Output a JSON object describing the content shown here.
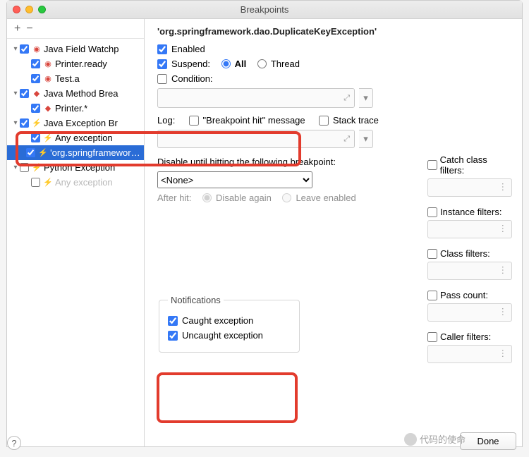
{
  "window": {
    "title": "Breakpoints"
  },
  "toolbar": {
    "add": "+",
    "remove": "−"
  },
  "tree": [
    {
      "level": 0,
      "arrow": "▾",
      "checked": true,
      "iconClass": "eye",
      "icon": "◉",
      "label": "Java Field Watchp",
      "sel": false,
      "enabled": true
    },
    {
      "level": 1,
      "arrow": "",
      "checked": true,
      "iconClass": "eye",
      "icon": "◉",
      "label": "Printer.ready",
      "sel": false,
      "enabled": true
    },
    {
      "level": 1,
      "arrow": "",
      "checked": true,
      "iconClass": "eye",
      "icon": "◉",
      "label": "Test.a",
      "sel": false,
      "enabled": true
    },
    {
      "level": 0,
      "arrow": "▾",
      "checked": true,
      "iconClass": "diamond",
      "icon": "◆",
      "label": "Java Method Brea",
      "sel": false,
      "enabled": true
    },
    {
      "level": 1,
      "arrow": "",
      "checked": true,
      "iconClass": "diamond",
      "icon": "◆",
      "label": "Printer.*",
      "sel": false,
      "enabled": true
    },
    {
      "level": 0,
      "arrow": "▾",
      "checked": true,
      "iconClass": "bolt",
      "icon": "⚡",
      "label": "Java Exception Br",
      "sel": false,
      "enabled": true
    },
    {
      "level": 1,
      "arrow": "",
      "checked": true,
      "iconClass": "bolt",
      "icon": "⚡",
      "label": "Any exception",
      "sel": false,
      "enabled": true
    },
    {
      "level": 1,
      "arrow": "",
      "checked": true,
      "iconClass": "bolt",
      "icon": "⚡",
      "label": "'org.springframework.dao.DuplicateKeyException'",
      "sel": true,
      "enabled": true
    },
    {
      "level": 0,
      "arrow": "▾",
      "checked": false,
      "iconClass": "bolt",
      "icon": "⚡",
      "label": "Python Exception",
      "sel": false,
      "enabled": true
    },
    {
      "level": 1,
      "arrow": "",
      "checked": false,
      "iconClass": "bolt",
      "icon": "⚡",
      "label": "Any exception",
      "sel": false,
      "enabled": false
    }
  ],
  "detail": {
    "header": "'org.springframework.dao.DuplicateKeyException'",
    "enabled_label": "Enabled",
    "suspend_label": "Suspend:",
    "suspend_all": "All",
    "suspend_thread": "Thread",
    "condition_label": "Condition:",
    "log_label": "Log:",
    "log_hit": "\"Breakpoint hit\" message",
    "stack_trace": "Stack trace",
    "disable_until": "Disable until hitting the following breakpoint:",
    "none_option": "<None>",
    "after_hit": "After hit:",
    "disable_again": "Disable again",
    "leave_enabled": "Leave enabled",
    "notifications_legend": "Notifications",
    "caught": "Caught exception",
    "uncaught": "Uncaught exception"
  },
  "filters": {
    "catch": "Catch class filters:",
    "instance": "Instance filters:",
    "class": "Class filters:",
    "pass": "Pass count:",
    "caller": "Caller filters:"
  },
  "footer": {
    "done": "Done",
    "help": "?"
  },
  "watermark": "代码的使命"
}
